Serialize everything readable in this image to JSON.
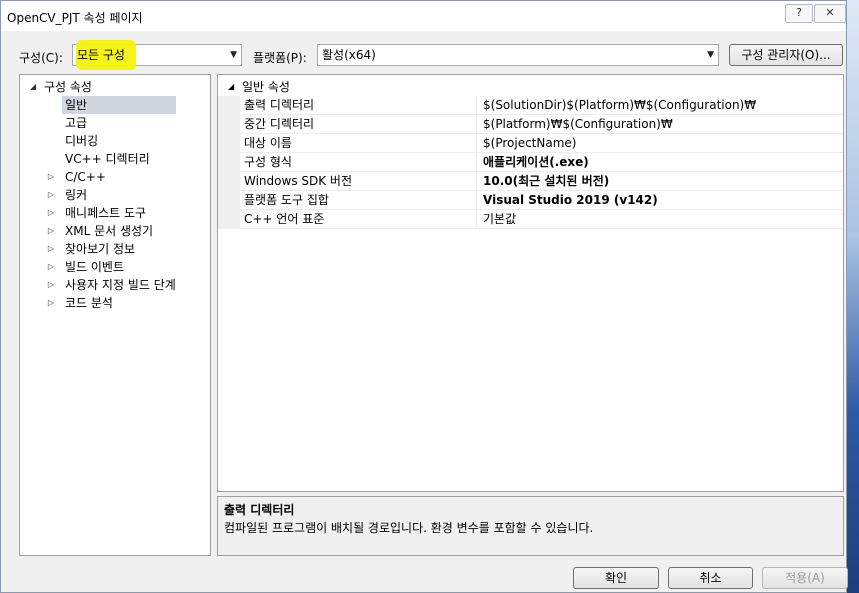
{
  "window": {
    "title": "OpenCV_PJT 속성 페이지",
    "help_label": "?",
    "close_label": "✕"
  },
  "toolbar": {
    "config_label": "구성(C):",
    "config_value": "모든 구성",
    "platform_label": "플랫폼(P):",
    "platform_value": "활성(x64)",
    "manager_button": "구성 관리자(O)..."
  },
  "tree": {
    "root": "구성 속성",
    "items": [
      {
        "label": "일반",
        "selected": true,
        "expandable": false
      },
      {
        "label": "고급",
        "expandable": false
      },
      {
        "label": "디버깅",
        "expandable": false
      },
      {
        "label": "VC++ 디렉터리",
        "expandable": false
      },
      {
        "label": "C/C++",
        "expandable": true
      },
      {
        "label": "링커",
        "expandable": true
      },
      {
        "label": "매니페스트 도구",
        "expandable": true
      },
      {
        "label": "XML 문서 생성기",
        "expandable": true
      },
      {
        "label": "찾아보기 정보",
        "expandable": true
      },
      {
        "label": "빌드 이벤트",
        "expandable": true
      },
      {
        "label": "사용자 지정 빌드 단계",
        "expandable": true
      },
      {
        "label": "코드 분석",
        "expandable": true
      }
    ]
  },
  "grid": {
    "section": "일반 속성",
    "rows": [
      {
        "name": "출력 디렉터리",
        "value": "$(SolutionDir)$(Platform)₩$(Configuration)₩",
        "bold": false
      },
      {
        "name": "중간 디렉터리",
        "value": "$(Platform)₩$(Configuration)₩",
        "bold": false
      },
      {
        "name": "대상 이름",
        "value": "$(ProjectName)",
        "bold": false
      },
      {
        "name": "구성 형식",
        "value": "애플리케이션(.exe)",
        "bold": true
      },
      {
        "name": "Windows SDK 버전",
        "value": "10.0(최근 설치된 버전)",
        "bold": true
      },
      {
        "name": "플랫폼 도구 집합",
        "value": "Visual Studio 2019 (v142)",
        "bold": true
      },
      {
        "name": "C++ 언어 표준",
        "value": "기본값",
        "bold": false
      }
    ]
  },
  "description": {
    "title": "출력 디렉터리",
    "text": "컴파일된 프로그램이 배치될 경로입니다. 환경 변수를 포함할 수 있습니다."
  },
  "buttons": {
    "ok": "확인",
    "cancel": "취소",
    "apply": "적용(A)"
  },
  "colors": {
    "highlight": "#f4f30e",
    "selected_row": "#cfd6e0"
  }
}
